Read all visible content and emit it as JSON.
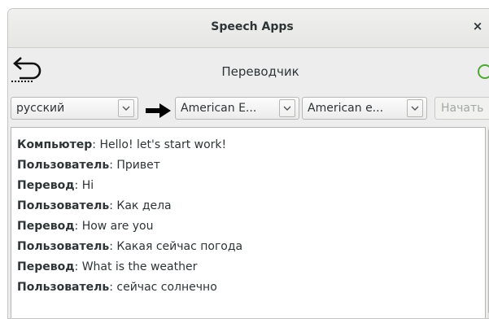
{
  "window": {
    "title": "Speech Apps",
    "close_glyph": "×"
  },
  "header": {
    "title": "Переводчик",
    "back_icon": "undo-arrow-icon",
    "status_icon": "status-circle-icon",
    "status_color": "#4ea832"
  },
  "toolbar": {
    "source_language": "русский",
    "direction_icon": "right-arrow-icon",
    "target_language": "American E...",
    "voice": "American e...",
    "start_label": "Начать"
  },
  "conversation": [
    {
      "speaker": "Компьютер",
      "separator": ": ",
      "text": "Hello! let's start work!"
    },
    {
      "speaker": "Пользователь",
      "separator": ": ",
      "text": "Привет"
    },
    {
      "speaker": "Перевод",
      "separator": ": ",
      "text": "Hi"
    },
    {
      "speaker": "Пользователь",
      "separator": ": ",
      "text": "Как дела"
    },
    {
      "speaker": "Перевод",
      "separator": ": ",
      "text": "How are you"
    },
    {
      "speaker": "Пользователь",
      "separator": ": ",
      "text": "Какая сейчас погода"
    },
    {
      "speaker": "Перевод",
      "separator": ": ",
      "text": "What is the weather"
    },
    {
      "speaker": "Пользователь",
      "separator": ": ",
      "text": "сейчас солнечно"
    }
  ]
}
